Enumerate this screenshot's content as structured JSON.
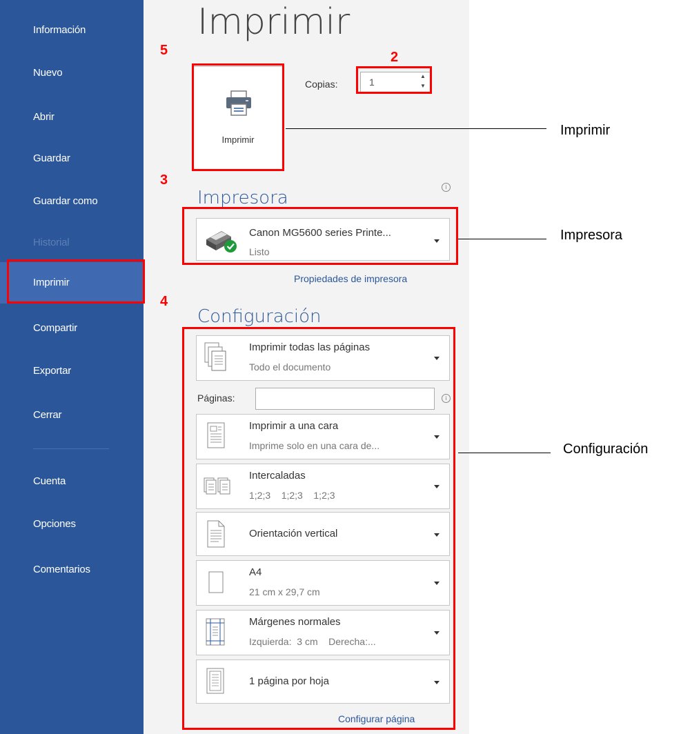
{
  "sidebar": {
    "items": [
      {
        "label": "Información"
      },
      {
        "label": "Nuevo"
      },
      {
        "label": "Abrir"
      },
      {
        "label": "Guardar"
      },
      {
        "label": "Guardar como"
      },
      {
        "label": "Historial"
      },
      {
        "label": "Imprimir"
      },
      {
        "label": "Compartir"
      },
      {
        "label": "Exportar"
      },
      {
        "label": "Cerrar"
      },
      {
        "label": "Cuenta"
      },
      {
        "label": "Opciones"
      },
      {
        "label": "Comentarios"
      }
    ]
  },
  "print": {
    "title": "Imprimir",
    "button_label": "Imprimir",
    "copies_label": "Copias:",
    "copies_value": "1"
  },
  "printer": {
    "section_title": "Impresora",
    "name": "Canon MG5600 series Printe...",
    "status": "Listo",
    "properties_link": "Propiedades de impresora"
  },
  "settings": {
    "section_title": "Configuración",
    "pages_label": "Páginas:",
    "pages_value": "",
    "items": [
      {
        "title": "Imprimir todas las páginas",
        "subtitle": "Todo el documento",
        "icon": "all-pages-icon"
      },
      {
        "title": "Imprimir a una cara",
        "subtitle": "Imprime solo en una cara de...",
        "icon": "one-sided-icon"
      },
      {
        "title": "Intercaladas",
        "subtitle": "1;2;3    1;2;3    1;2;3",
        "icon": "collated-icon"
      },
      {
        "title": "Orientación vertical",
        "subtitle": "",
        "icon": "portrait-icon"
      },
      {
        "title": "A4",
        "subtitle": "21 cm x 29,7 cm",
        "icon": "paper-size-icon"
      },
      {
        "title": "Márgenes normales",
        "subtitle": "Izquierda:  3 cm    Derecha:...",
        "icon": "margins-icon"
      },
      {
        "title": "1 página por hoja",
        "subtitle": "",
        "icon": "pages-per-sheet-icon"
      }
    ],
    "page_setup_link": "Configurar página"
  },
  "annotations": {
    "numbers": [
      "5",
      "2",
      "3",
      "4"
    ],
    "callouts": [
      "Imprimir",
      "Impresora",
      "Configuración"
    ],
    "highlight_color": "#ff0000"
  },
  "colors": {
    "sidebar": "#2b579a",
    "sidebar_selected": "#3f6ab1",
    "accent": "#2b579a",
    "panel": "#f3f3f3"
  }
}
